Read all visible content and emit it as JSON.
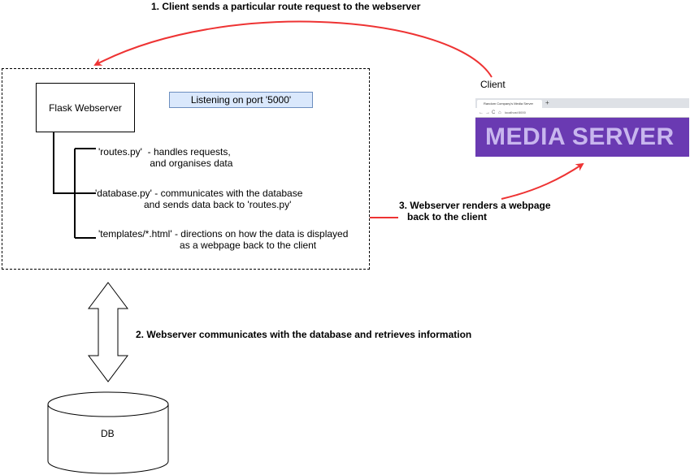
{
  "labels": {
    "step1": "1. Client sends a particular route request to the webserver",
    "client": "Client",
    "step2": "2. Webserver communicates with the database and retrieves information",
    "step3": "3. Webserver renders a webpage\n   back to the client",
    "db": "DB"
  },
  "webserver": {
    "title": "Flask Webserver",
    "port": "Listening on port '5000'",
    "files": [
      {
        "text": "'routes.py'  - handles requests,\n                   and organises data"
      },
      {
        "text": "'database.py' - communicates with the database\n                  and sends data back to 'routes.py'"
      },
      {
        "text": "'templates/*.html' - directions on how the data is displayed\n                              as a webpage back to the client"
      }
    ]
  },
  "browser": {
    "tab_title": "Random Company's Media Server",
    "tab_plus": "+",
    "nav_back": "←",
    "nav_forward": "→",
    "nav_reload": "C",
    "nav_home": "⌂",
    "url": "localhost:5000",
    "banner": "MEDIA SERVER"
  },
  "colors": {
    "arrow": "#ee3333",
    "port_fill": "#dae8fc",
    "port_stroke": "#6c8ebf",
    "banner": "#6a3ab2",
    "banner_text": "#c8b6ee"
  }
}
